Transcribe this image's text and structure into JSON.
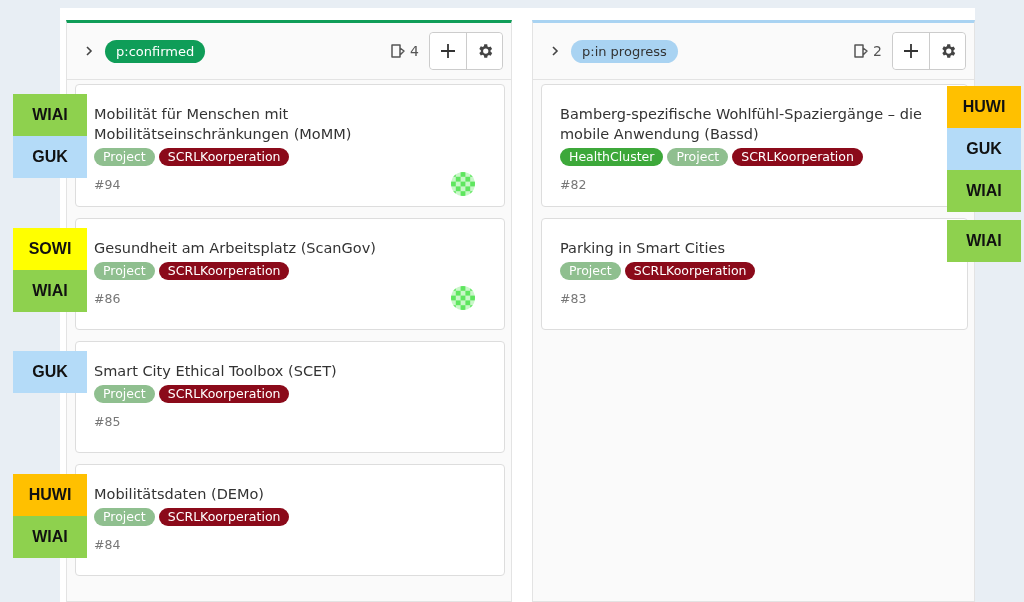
{
  "columns": [
    {
      "label": "p:confirmed",
      "color": "#0f9d58",
      "count": "4",
      "cards": [
        {
          "title": "Mobilität für Menschen mit Mobilitätseinschränkungen (MoMM)",
          "tags": [
            {
              "label": "Project",
              "color": "#8fbf8f"
            },
            {
              "label": "SCRLKoorperation",
              "color": "#8b0a1a"
            }
          ],
          "number": "#94",
          "has_avatar": true,
          "notes": [
            {
              "label": "WIAI",
              "color": "#8ed14e"
            },
            {
              "label": "GUK",
              "color": "#b4dbf8"
            }
          ]
        },
        {
          "title": "Gesundheit am Arbeitsplatz (ScanGov)",
          "tags": [
            {
              "label": "Project",
              "color": "#8fbf8f"
            },
            {
              "label": "SCRLKoorperation",
              "color": "#8b0a1a"
            }
          ],
          "number": "#86",
          "has_avatar": true,
          "notes": [
            {
              "label": "SOWI",
              "color": "#ffff00"
            },
            {
              "label": "WIAI",
              "color": "#8ed14e"
            }
          ]
        },
        {
          "title": "Smart City Ethical Toolbox (SCET)",
          "tags": [
            {
              "label": "Project",
              "color": "#8fbf8f"
            },
            {
              "label": "SCRLKoorperation",
              "color": "#8b0a1a"
            }
          ],
          "number": "#85",
          "has_avatar": false,
          "notes": [
            {
              "label": "GUK",
              "color": "#b4dbf8"
            }
          ]
        },
        {
          "title": "Mobilitätsdaten (DEMo)",
          "tags": [
            {
              "label": "Project",
              "color": "#8fbf8f"
            },
            {
              "label": "SCRLKoorperation",
              "color": "#8b0a1a"
            }
          ],
          "number": "#84",
          "has_avatar": false,
          "notes": [
            {
              "label": "HUWI",
              "color": "#ffc000"
            },
            {
              "label": "WIAI",
              "color": "#8ed14e"
            }
          ]
        }
      ]
    },
    {
      "label": "p:in progress",
      "color": "#a9d3f2",
      "count": "2",
      "cards": [
        {
          "title": "Bamberg-spezifische Wohlfühl-Spaziergänge – die mobile Anwendung (Bassd)",
          "tags": [
            {
              "label": "HealthCluster",
              "color": "#3da83a"
            },
            {
              "label": "Project",
              "color": "#8fbf8f"
            },
            {
              "label": "SCRLKoorperation",
              "color": "#8b0a1a"
            }
          ],
          "number": "#82",
          "has_avatar": false,
          "notes": [
            {
              "label": "HUWI",
              "color": "#ffc000"
            },
            {
              "label": "GUK",
              "color": "#b4dbf8"
            },
            {
              "label": "WIAI",
              "color": "#8ed14e"
            }
          ]
        },
        {
          "title": "Parking in Smart Cities",
          "tags": [
            {
              "label": "Project",
              "color": "#8fbf8f"
            },
            {
              "label": "SCRLKoorperation",
              "color": "#8b0a1a"
            }
          ],
          "number": "#83",
          "has_avatar": false,
          "notes": [
            {
              "label": "WIAI",
              "color": "#8ed14e"
            }
          ]
        }
      ]
    }
  ]
}
